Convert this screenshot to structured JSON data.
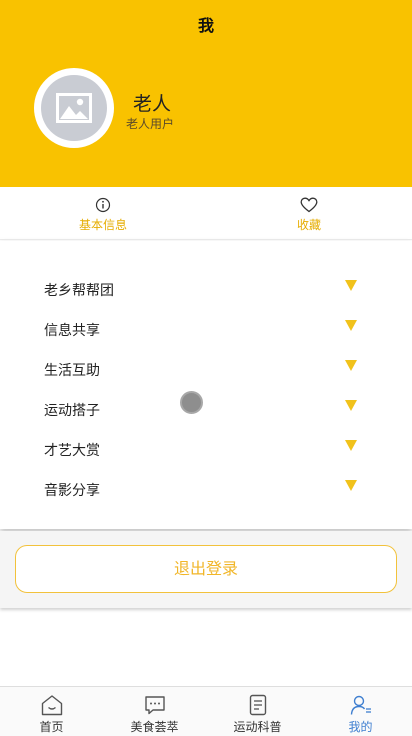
{
  "header": {
    "title": "我"
  },
  "profile": {
    "name": "老人",
    "role": "老人用户"
  },
  "tabs": [
    {
      "label": "基本信息",
      "icon": "info-icon"
    },
    {
      "label": "收藏",
      "icon": "heart-icon"
    }
  ],
  "menu": {
    "items": [
      {
        "label": "老乡帮帮团"
      },
      {
        "label": "信息共享"
      },
      {
        "label": "生活互助"
      },
      {
        "label": "运动搭子"
      },
      {
        "label": "才艺大赏"
      },
      {
        "label": "音影分享"
      }
    ]
  },
  "logout": {
    "label": "退出登录"
  },
  "bottom_nav": {
    "items": [
      {
        "label": "首页",
        "icon": "home-icon"
      },
      {
        "label": "美食荟萃",
        "icon": "chat-icon"
      },
      {
        "label": "运动科普",
        "icon": "document-icon"
      },
      {
        "label": "我的",
        "icon": "user-icon"
      }
    ],
    "active": "我的"
  },
  "colors": {
    "brand": "#f9c200",
    "accent": "#f1b628",
    "active_nav": "#3f7fd0"
  }
}
